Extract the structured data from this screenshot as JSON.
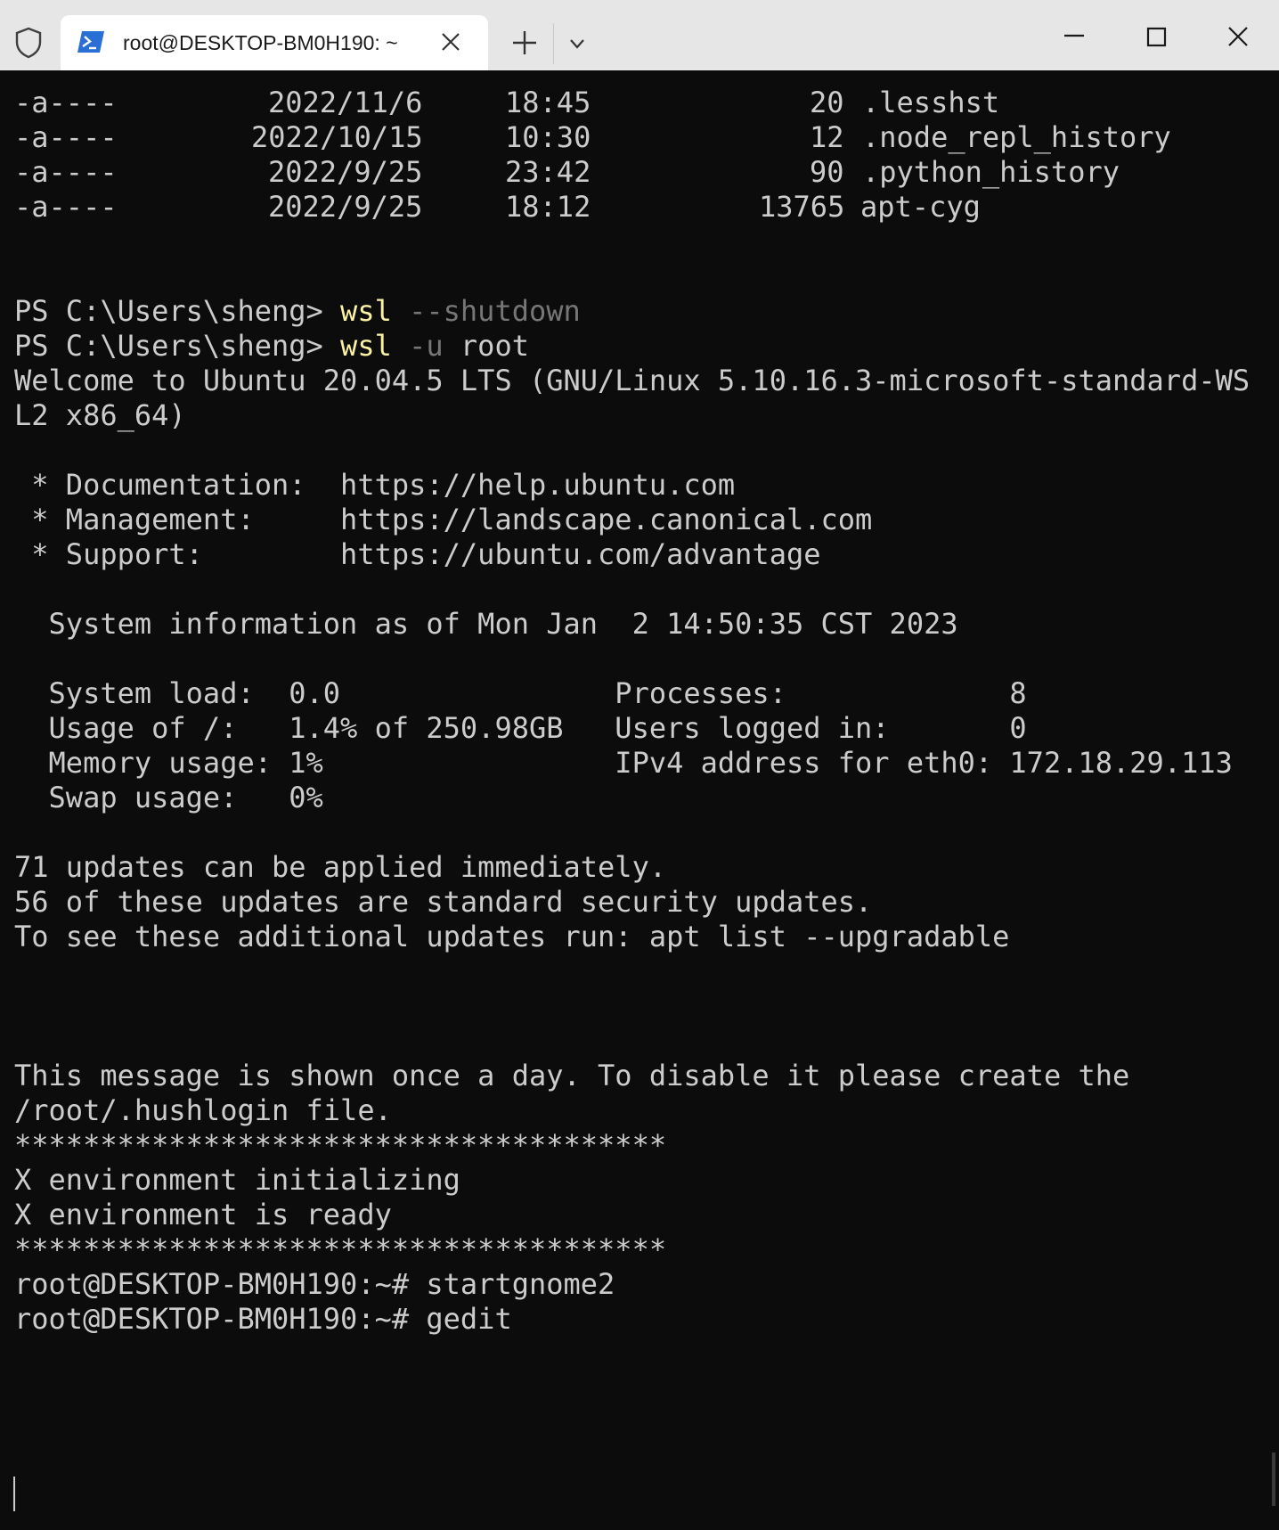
{
  "window": {
    "tab_title": "root@DESKTOP-BM0H190: ~",
    "icons": {
      "shield": "shield-icon",
      "tab": "powershell-icon",
      "tab_close": "close-icon",
      "new_tab": "plus-icon",
      "dropdown": "chevron-down-icon",
      "minimize": "minimize-icon",
      "maximize": "maximize-icon",
      "close": "close-icon"
    }
  },
  "colors": {
    "background": "#0c0c0c",
    "foreground": "#cccccc",
    "command": "#f9f1a5",
    "parameter": "#767676"
  },
  "terminal": {
    "files": [
      {
        "mode": "-a----",
        "date": "2022/11/6",
        "time": "18:45",
        "size": "20",
        "name": ".lesshst"
      },
      {
        "mode": "-a----",
        "date": "2022/10/15",
        "time": "10:30",
        "size": "12",
        "name": ".node_repl_history"
      },
      {
        "mode": "-a----",
        "date": "2022/9/25",
        "time": "23:42",
        "size": "90",
        "name": ".python_history"
      },
      {
        "mode": "-a----",
        "date": "2022/9/25",
        "time": "18:12",
        "size": "13765",
        "name": "apt-cyg"
      }
    ],
    "ps_commands": [
      {
        "prompt": "PS C:\\Users\\sheng> ",
        "cmd": "wsl",
        "args": " --shutdown"
      },
      {
        "prompt": "PS C:\\Users\\sheng> ",
        "cmd": "wsl",
        "param": " -u",
        "args": " root"
      }
    ],
    "welcome": [
      "Welcome to Ubuntu 20.04.5 LTS (GNU/Linux 5.10.16.3-microsoft-standard-WS",
      "L2 x86_64)"
    ],
    "links": [
      " * Documentation:  https://help.ubuntu.com",
      " * Management:     https://landscape.canonical.com",
      " * Support:        https://ubuntu.com/advantage"
    ],
    "sysinfo_header": "  System information as of Mon Jan  2 14:50:35 CST 2023",
    "sysinfo": [
      "  System load:  0.0                Processes:             8",
      "  Usage of /:   1.4% of 250.98GB   Users logged in:       0",
      "  Memory usage: 1%                 IPv4 address for eth0: 172.18.29.113",
      "  Swap usage:   0%"
    ],
    "updates": [
      "71 updates can be applied immediately.",
      "56 of these updates are standard security updates.",
      "To see these additional updates run: apt list --upgradable"
    ],
    "motd": [
      "This message is shown once a day. To disable it please create the",
      "/root/.hushlogin file."
    ],
    "xenv": [
      "**************************************",
      "X environment initializing",
      "X environment is ready",
      "**************************************"
    ],
    "root_commands": [
      "root@DESKTOP-BM0H190:~# startgnome2",
      "root@DESKTOP-BM0H190:~# gedit"
    ]
  }
}
